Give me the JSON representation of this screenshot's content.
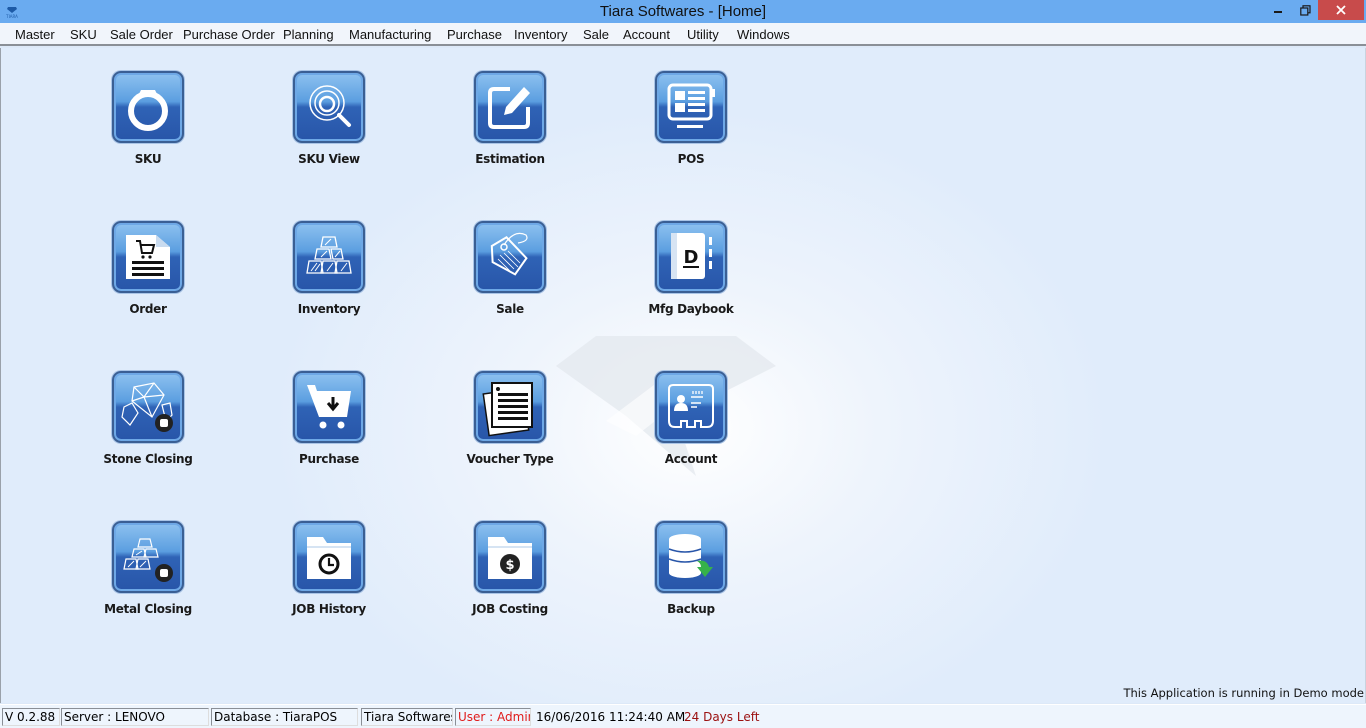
{
  "window": {
    "title": "Tiara Softwares - [Home]",
    "logo_text": "TIARA",
    "controls": [
      "minimize",
      "restore",
      "close"
    ]
  },
  "menu": [
    {
      "label": "Master"
    },
    {
      "label": "SKU"
    },
    {
      "label": "Sale Order"
    },
    {
      "label": "Purchase Order"
    },
    {
      "label": "Planning"
    },
    {
      "label": "Manufacturing"
    },
    {
      "label": "Purchase"
    },
    {
      "label": "Inventory"
    },
    {
      "label": "Sale"
    },
    {
      "label": "Account"
    },
    {
      "label": "Utility"
    },
    {
      "label": "Windows"
    }
  ],
  "tiles": [
    {
      "label": "SKU",
      "icon": "ring-icon"
    },
    {
      "label": "SKU View",
      "icon": "ring-search-icon"
    },
    {
      "label": "Estimation",
      "icon": "edit-pencil-icon"
    },
    {
      "label": "POS",
      "icon": "pos-monitor-icon"
    },
    {
      "label": "Order",
      "icon": "order-cart-document-icon"
    },
    {
      "label": "Inventory",
      "icon": "gold-bars-stack-icon"
    },
    {
      "label": "Sale",
      "icon": "price-tag-icon"
    },
    {
      "label": "Mfg Daybook",
      "icon": "daybook-icon"
    },
    {
      "label": "Stone Closing",
      "icon": "diamonds-close-icon"
    },
    {
      "label": "Purchase",
      "icon": "cart-download-icon"
    },
    {
      "label": "Voucher Type",
      "icon": "voucher-stack-icon"
    },
    {
      "label": "Account",
      "icon": "account-card-icon"
    },
    {
      "label": "Metal Closing",
      "icon": "metal-bars-close-icon"
    },
    {
      "label": "JOB History",
      "icon": "folder-clock-icon"
    },
    {
      "label": "JOB Costing",
      "icon": "folder-dollar-icon"
    },
    {
      "label": "Backup",
      "icon": "database-backup-icon"
    }
  ],
  "demo_note": "This Application is running in Demo mode",
  "status": {
    "version": "V 0.2.88",
    "server": "Server : LENOVO",
    "database": "Database : TiaraPOS",
    "company": "Tiara Softwares",
    "user": "User : Admin",
    "datetime": "16/06/2016 11:24:40 AM",
    "days_left": "24 Days Left"
  },
  "colors": {
    "titlebar": "#6aabf0",
    "close_button": "#c84b4b",
    "user_text": "#e01b1b",
    "days_left_text": "#9b1010",
    "icon_blue": "#2f63b6"
  }
}
